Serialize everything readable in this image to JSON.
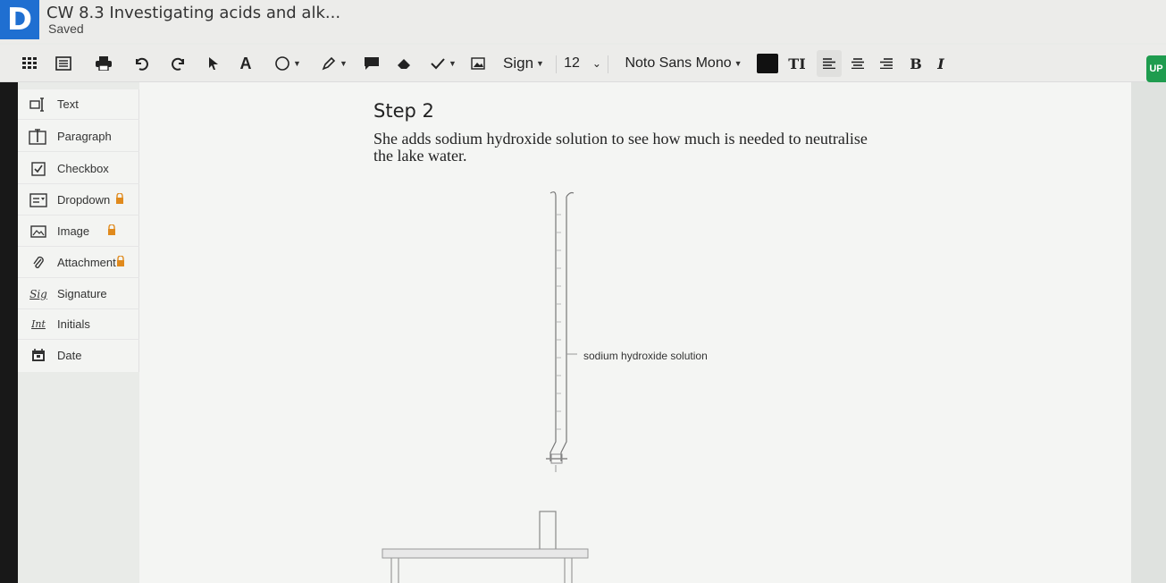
{
  "header": {
    "logo": "D",
    "title": "CW 8.3 Investigating acids and alk...",
    "status": "Saved",
    "badge": "UP"
  },
  "toolbar": {
    "text_icon": "A",
    "sign_label": "Sign",
    "font_size": "12",
    "font_family": "Noto Sans Mono",
    "text_size_icon": "TI",
    "bold": "B",
    "italic": "I"
  },
  "panel": {
    "items": [
      {
        "label": "Text",
        "icon": "text-box-icon",
        "locked": false
      },
      {
        "label": "Paragraph",
        "icon": "paragraph-icon",
        "locked": false
      },
      {
        "label": "Checkbox",
        "icon": "checkbox-icon",
        "locked": false
      },
      {
        "label": "Dropdown",
        "icon": "dropdown-icon",
        "locked": true
      },
      {
        "label": "Image",
        "icon": "image-icon",
        "locked": true
      },
      {
        "label": "Attachment",
        "icon": "paperclip-icon",
        "locked": true
      },
      {
        "label": "Signature",
        "icon": "signature-icon",
        "locked": false
      },
      {
        "label": "Initials",
        "icon": "initials-icon",
        "locked": false
      },
      {
        "label": "Date",
        "icon": "calendar-icon",
        "locked": false
      }
    ],
    "signature_glyph": "Sig",
    "initials_glyph": "Int"
  },
  "document": {
    "step": "Step 2",
    "paragraph": "She adds sodium hydroxide solution to see how much is needed to neutralise the lake water.",
    "burette_label": "sodium hydroxide solution"
  },
  "colors": {
    "brand": "#1f6fd1",
    "badge": "#1f9c4f",
    "lock": "#e08a1d"
  }
}
